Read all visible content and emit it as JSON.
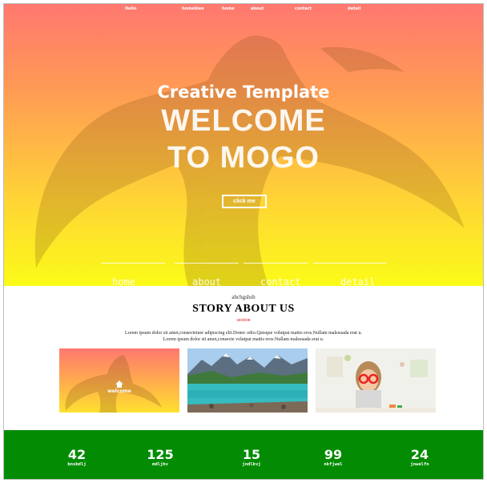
{
  "top_nav": [
    "Hello",
    "homeblee",
    "home",
    "about",
    "contact",
    "detail"
  ],
  "hero": {
    "subtitle": "Creative Template",
    "title_line1": "WELCOME",
    "title_line2": "TO MOGO",
    "button_label": "click me"
  },
  "section_nav": [
    "home",
    "about",
    "contact",
    "detail"
  ],
  "story": {
    "kicker": "abchgshsb",
    "title": "STORY ABOUT US",
    "section": "section",
    "body_line1": "Lorem ipsum dolor sit amet,consectetuer adipiscing elit.Donec odio.Quisque volutpat mattis eros.Nullam malesuada erat u.",
    "body_line2": "Lorem ipsum dolor sit amet,consecte volutpat mattis eros.Nullam malesuada erat u."
  },
  "gallery": {
    "tile1_label": "welcome"
  },
  "stats": [
    {
      "value": "42",
      "label": "bnsbdlj"
    },
    {
      "value": "125",
      "label": "mdljhv"
    },
    {
      "value": "15",
      "label": "jndlkvj"
    },
    {
      "value": "99",
      "label": "nkfjwel"
    },
    {
      "value": "24",
      "label": "jnwelfn"
    }
  ],
  "colors": {
    "hero_top": "#ff7870",
    "hero_bottom": "#fbfb18",
    "stats_bg": "#038c03",
    "section_red": "#dd1111"
  }
}
